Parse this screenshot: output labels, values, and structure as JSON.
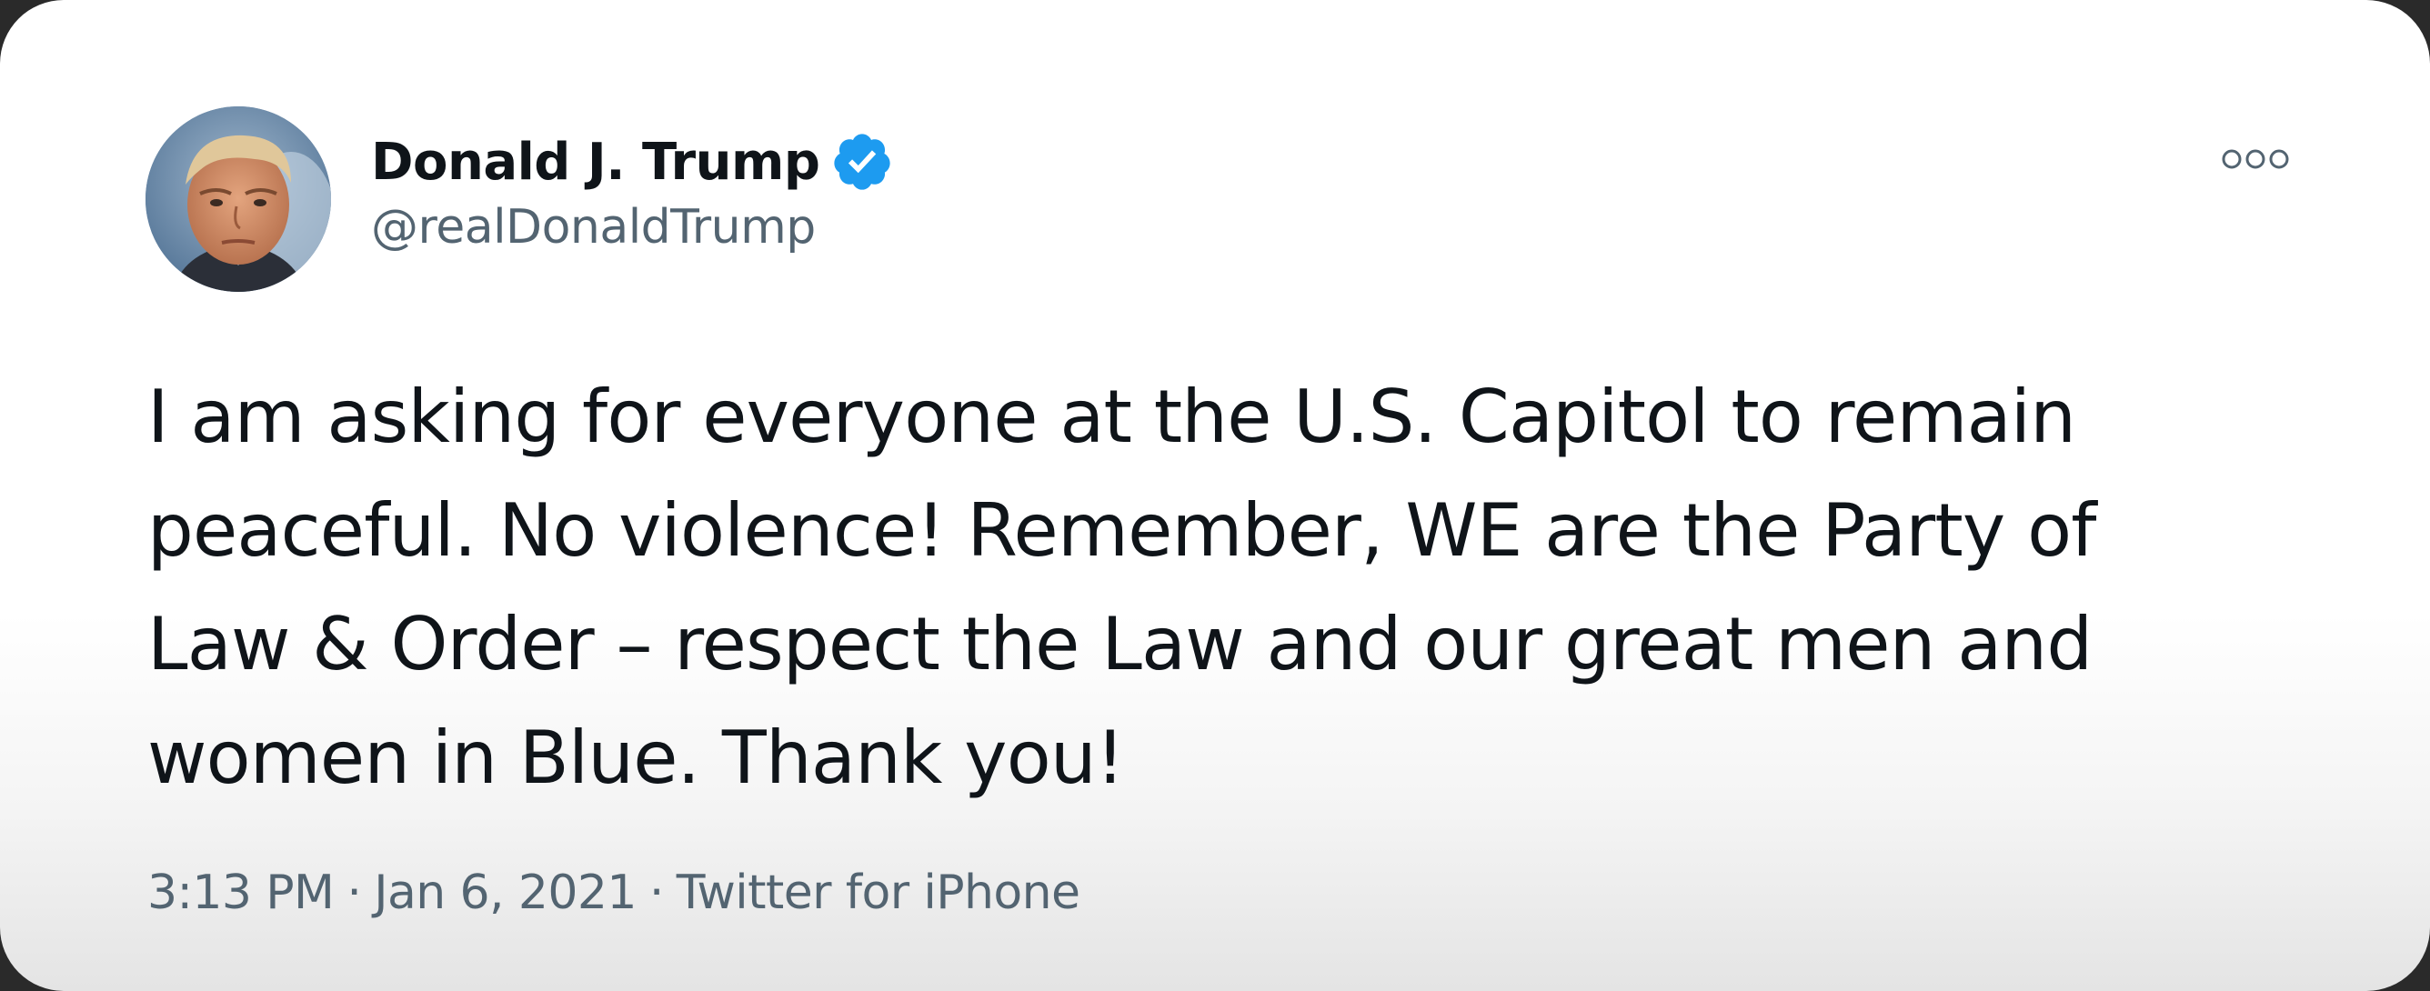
{
  "author": {
    "display_name": "Donald J. Trump",
    "handle": "@realDonaldTrump",
    "verified": true,
    "verified_color": "#1d9bf0",
    "avatar_icon": "profile-photo"
  },
  "menu": {
    "icon": "more-options-icon"
  },
  "tweet": {
    "text": "I am asking for everyone at the U.S. Capitol to remain\npeaceful. No violence! Remember, WE are the Party of\nLaw & Order – respect the Law and our great men and\nwomen in Blue. Thank you!"
  },
  "meta": {
    "time": "3:13 PM",
    "date": "Jan 6, 2021",
    "source": "Twitter for iPhone",
    "separator": "·"
  },
  "colors": {
    "text_primary": "#0f1419",
    "text_secondary": "#536471",
    "background": "#ffffff"
  }
}
